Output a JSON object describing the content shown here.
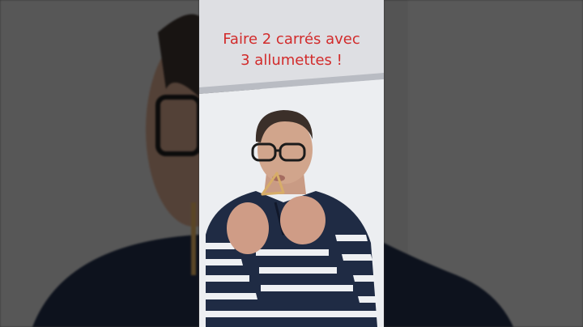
{
  "video": {
    "caption_line1": "Faire 2 carrés avec",
    "caption_line2": "3 allumettes !"
  },
  "colors": {
    "caption": "#d22b2b",
    "wall": "#e9eaec",
    "sweater_navy": "#1f2b44",
    "stripe": "#eef0f3"
  }
}
